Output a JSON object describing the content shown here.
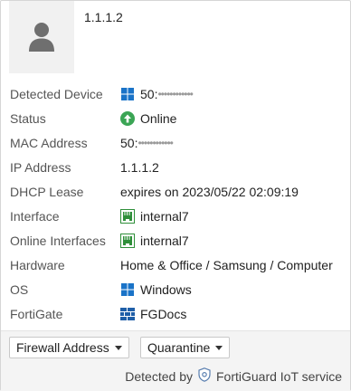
{
  "header": {
    "title": "1.1.1.2",
    "avatar_icon": "user-silhouette-icon"
  },
  "details": [
    {
      "key": "detected_device",
      "label": "Detected Device",
      "value": "50:",
      "masked": "••••••••••••",
      "icon": "windows-icon"
    },
    {
      "key": "status",
      "label": "Status",
      "value": "Online",
      "icon": "online-arrow-up-icon"
    },
    {
      "key": "mac_address",
      "label": "MAC Address",
      "value": "50:",
      "masked": "••••••••••••"
    },
    {
      "key": "ip_address",
      "label": "IP Address",
      "value": "1.1.1.2"
    },
    {
      "key": "dhcp_lease",
      "label": "DHCP Lease",
      "value": "expires on 2023/05/22 02:09:19"
    },
    {
      "key": "interface",
      "label": "Interface",
      "value": "internal7",
      "icon": "ethernet-port-icon"
    },
    {
      "key": "online_interfaces",
      "label": "Online Interfaces",
      "value": "internal7",
      "icon": "ethernet-port-icon"
    },
    {
      "key": "hardware",
      "label": "Hardware",
      "value": "Home & Office / Samsung / Computer"
    },
    {
      "key": "os",
      "label": "OS",
      "value": "Windows",
      "icon": "windows-icon"
    },
    {
      "key": "fortigate",
      "label": "FortiGate",
      "value": "FGDocs",
      "icon": "fortigate-icon"
    }
  ],
  "footer": {
    "firewall_address_label": "Firewall Address",
    "quarantine_label": "Quarantine",
    "detected_by": "Detected by",
    "service": "FortiGuard IoT service"
  },
  "colors": {
    "windows_blue": "#1a73c8",
    "online_green": "#3ba555",
    "port_green": "#2f8f3a",
    "fortigate_blue": "#1f5fa8"
  }
}
